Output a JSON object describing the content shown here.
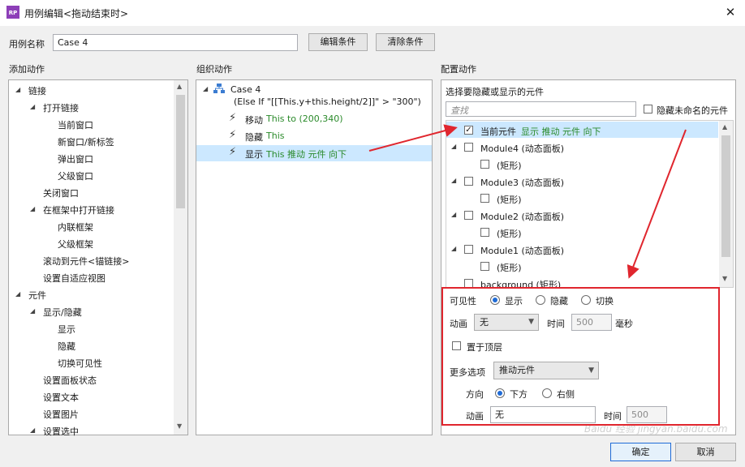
{
  "window": {
    "title": "用例编辑<拖动结束时>",
    "app_badge": "RP"
  },
  "case_name": {
    "label": "用例名称",
    "value": "Case 4",
    "edit_condition": "编辑条件",
    "clear_condition": "清除条件"
  },
  "add_actions": {
    "header": "添加动作",
    "items": [
      {
        "label": "链接",
        "level": 1,
        "expander": true
      },
      {
        "label": "打开链接",
        "level": 2,
        "expander": true
      },
      {
        "label": "当前窗口",
        "level": 3,
        "expander": false
      },
      {
        "label": "新窗口/新标签",
        "level": 3,
        "expander": false
      },
      {
        "label": "弹出窗口",
        "level": 3,
        "expander": false
      },
      {
        "label": "父级窗口",
        "level": 3,
        "expander": false
      },
      {
        "label": "关闭窗口",
        "level": 2,
        "expander": false
      },
      {
        "label": "在框架中打开链接",
        "level": 2,
        "expander": true
      },
      {
        "label": "内联框架",
        "level": 3,
        "expander": false
      },
      {
        "label": "父级框架",
        "level": 3,
        "expander": false
      },
      {
        "label": "滚动到元件<锚链接>",
        "level": 2,
        "expander": false
      },
      {
        "label": "设置自适应视图",
        "level": 2,
        "expander": false
      },
      {
        "label": "元件",
        "level": 1,
        "expander": true
      },
      {
        "label": "显示/隐藏",
        "level": 2,
        "expander": true
      },
      {
        "label": "显示",
        "level": 3,
        "expander": false
      },
      {
        "label": "隐藏",
        "level": 3,
        "expander": false
      },
      {
        "label": "切换可见性",
        "level": 3,
        "expander": false
      },
      {
        "label": "设置面板状态",
        "level": 2,
        "expander": false
      },
      {
        "label": "设置文本",
        "level": 2,
        "expander": false
      },
      {
        "label": "设置图片",
        "level": 2,
        "expander": false
      },
      {
        "label": "设置选中",
        "level": 2,
        "expander": true
      }
    ]
  },
  "organize": {
    "header": "组织动作",
    "case_title": "Case 4",
    "case_condition": "(Else If \"[[This.y+this.height/2]]\" > \"300\")",
    "actions": [
      {
        "verb": "移动",
        "detail": "This to (200,340)"
      },
      {
        "verb": "隐藏",
        "detail": "This"
      },
      {
        "verb": "显示",
        "detail": "This 推动 元件 向下"
      }
    ]
  },
  "configure": {
    "header": "配置动作",
    "subheader": "选择要隐藏或显示的元件",
    "search_placeholder": "查找",
    "hide_unnamed_label": "隐藏未命名的元件",
    "widgets": [
      {
        "label": "当前元件",
        "detail": "显示 推动 元件 向下",
        "checked": true,
        "level": 1,
        "expander": false
      },
      {
        "label": "Module4 (动态面板)",
        "detail": "",
        "checked": false,
        "level": 1,
        "expander": true
      },
      {
        "label": "(矩形)",
        "detail": "",
        "checked": false,
        "level": 2,
        "expander": false
      },
      {
        "label": "Module3 (动态面板)",
        "detail": "",
        "checked": false,
        "level": 1,
        "expander": true
      },
      {
        "label": "(矩形)",
        "detail": "",
        "checked": false,
        "level": 2,
        "expander": false
      },
      {
        "label": "Module2 (动态面板)",
        "detail": "",
        "checked": false,
        "level": 1,
        "expander": true
      },
      {
        "label": "(矩形)",
        "detail": "",
        "checked": false,
        "level": 2,
        "expander": false
      },
      {
        "label": "Module1 (动态面板)",
        "detail": "",
        "checked": false,
        "level": 1,
        "expander": true
      },
      {
        "label": "(矩形)",
        "detail": "",
        "checked": false,
        "level": 2,
        "expander": false
      },
      {
        "label": "background (矩形)",
        "detail": "",
        "checked": false,
        "level": 1,
        "expander": false
      }
    ],
    "visibility": {
      "label": "可见性",
      "show": "显示",
      "hide": "隐藏",
      "toggle": "切换",
      "selected": "显示"
    },
    "animation": {
      "label": "动画",
      "value": "无",
      "time_label": "时间",
      "time_value": "500",
      "unit": "毫秒"
    },
    "bring_to_front": "置于顶层",
    "more_options": {
      "label": "更多选项",
      "value": "推动元件"
    },
    "direction": {
      "label": "方向",
      "down": "下方",
      "right": "右侧",
      "selected": "下方"
    },
    "anim2": {
      "label": "动画",
      "value": "无",
      "time_label": "时间",
      "time_value": "500"
    }
  },
  "footer": {
    "ok": "确定",
    "cancel": "取消"
  },
  "watermark": "Baidu 经验 jingyan.baidu.com",
  "colors": {
    "annotation_red": "#e0262e",
    "accent_blue": "#1f6bd6",
    "selection": "#cce8ff"
  }
}
